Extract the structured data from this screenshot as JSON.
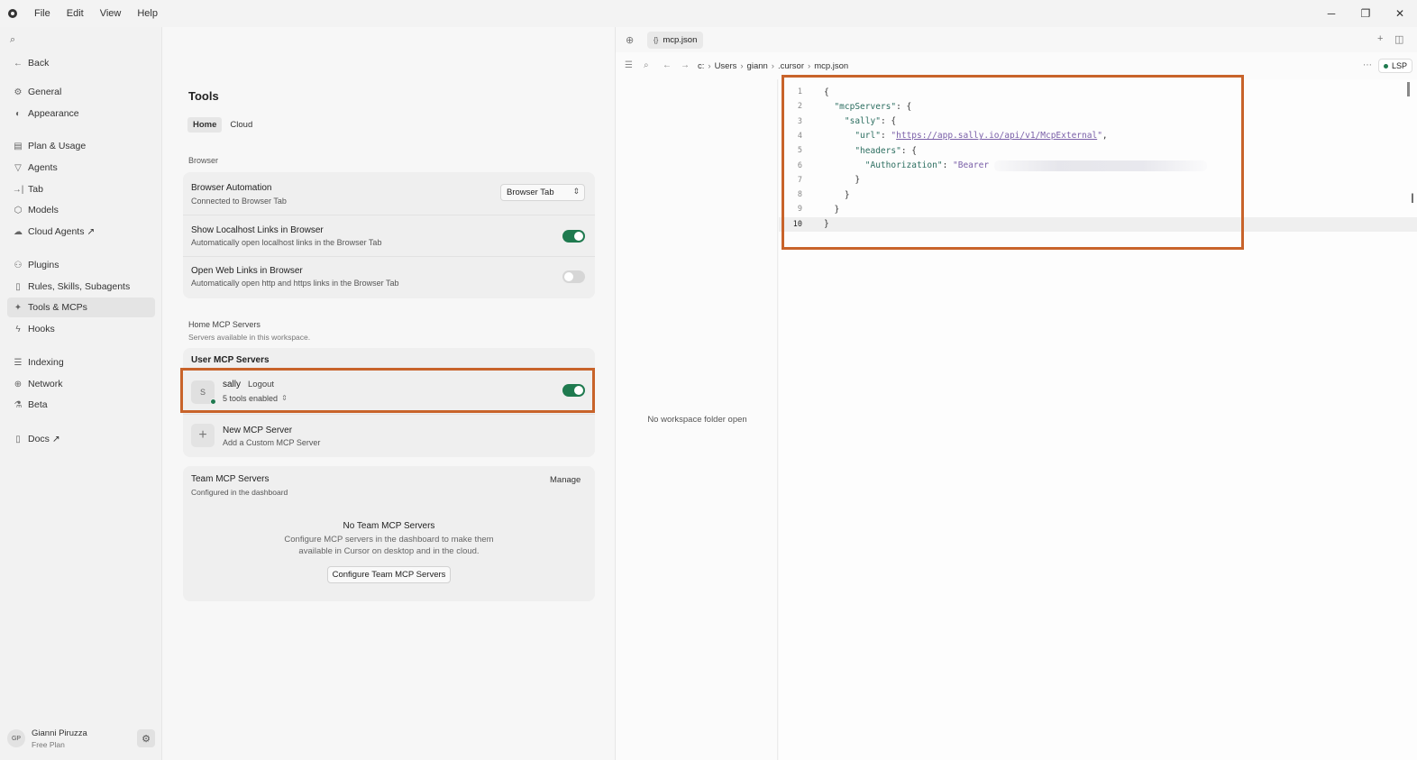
{
  "menubar": {
    "items": [
      "File",
      "Edit",
      "View",
      "Help"
    ],
    "controls": {
      "minimize": "─",
      "restore": "❐",
      "close": "✕"
    }
  },
  "sidebar": {
    "back_label": "Back",
    "items": [
      {
        "label": "General",
        "icon": "⚙"
      },
      {
        "label": "Appearance",
        "icon": "◐"
      },
      {
        "label": "Plan & Usage",
        "icon": "▤"
      },
      {
        "label": "Agents",
        "icon": "▽"
      },
      {
        "label": "Tab",
        "icon": "→|"
      },
      {
        "label": "Models",
        "icon": "⬡"
      },
      {
        "label": "Cloud Agents ↗",
        "icon": "☁"
      },
      {
        "label": "Plugins",
        "icon": "⚇"
      },
      {
        "label": "Rules, Skills, Subagents",
        "icon": "▯"
      },
      {
        "label": "Tools & MCPs",
        "icon": "✦"
      },
      {
        "label": "Hooks",
        "icon": "ϟ"
      },
      {
        "label": "Indexing",
        "icon": "☰"
      },
      {
        "label": "Network",
        "icon": "⊕"
      },
      {
        "label": "Beta",
        "icon": "⚗"
      },
      {
        "label": "Docs ↗",
        "icon": "▯"
      }
    ],
    "active_item": "Tools & MCPs",
    "user": {
      "initials": "GP",
      "name": "Gianni Piruzza",
      "plan": "Free Plan"
    }
  },
  "settings": {
    "title": "Tools",
    "tabs": [
      "Home",
      "Cloud"
    ],
    "browser_section": "Browser",
    "browser_automation": {
      "title": "Browser Automation",
      "subtitle": "Connected to Browser Tab",
      "select_value": "Browser Tab"
    },
    "localhost_links": {
      "title": "Show Localhost Links in Browser",
      "subtitle": "Automatically open localhost links in the Browser Tab",
      "enabled": true
    },
    "web_links": {
      "title": "Open Web Links in Browser",
      "subtitle": "Automatically open http and https links in the Browser Tab",
      "enabled": false
    },
    "home_mcp": {
      "title": "Home MCP Servers",
      "subtitle": "Servers available in this workspace."
    },
    "user_mcp": {
      "header": "User MCP Servers",
      "server": {
        "initial": "S",
        "name": "sally",
        "action": "Logout",
        "tools": "5 tools enabled",
        "enabled": true
      },
      "new_server": {
        "title": "New MCP Server",
        "subtitle": "Add a Custom MCP Server"
      }
    },
    "team_mcp": {
      "title": "Team MCP Servers",
      "subtitle": "Configured in the dashboard",
      "manage": "Manage",
      "empty_title": "No Team MCP Servers",
      "empty_line1": "Configure MCP servers in the dashboard to make them",
      "empty_line2": "available in Cursor on desktop and in the cloud.",
      "button": "Configure Team MCP Servers"
    }
  },
  "editor": {
    "tab_label": "mcp.json",
    "breadcrumbs": [
      "c:",
      "Users",
      "giann",
      ".cursor",
      "mcp.json"
    ],
    "lsp_label": "LSP",
    "no_folder": "No workspace folder open",
    "lines": [
      {
        "n": "1",
        "parts": [
          [
            "p",
            "{"
          ]
        ]
      },
      {
        "n": "2",
        "parts": [
          [
            "p",
            "  "
          ],
          [
            "k",
            "\"mcpServers\""
          ],
          [
            "p",
            ": {"
          ]
        ]
      },
      {
        "n": "3",
        "parts": [
          [
            "p",
            "    "
          ],
          [
            "k",
            "\"sally\""
          ],
          [
            "p",
            ": {"
          ]
        ]
      },
      {
        "n": "4",
        "parts": [
          [
            "p",
            "      "
          ],
          [
            "k",
            "\"url\""
          ],
          [
            "p",
            ": "
          ],
          [
            "s",
            "\""
          ],
          [
            "url",
            "https://app.sally.io/api/v1/McpExternal"
          ],
          [
            "s",
            "\""
          ],
          [
            "p",
            ","
          ]
        ]
      },
      {
        "n": "5",
        "parts": [
          [
            "p",
            "      "
          ],
          [
            "k",
            "\"headers\""
          ],
          [
            "p",
            ": {"
          ]
        ]
      },
      {
        "n": "6",
        "parts": [
          [
            "p",
            "        "
          ],
          [
            "k",
            "\"Authorization\""
          ],
          [
            "p",
            ": "
          ],
          [
            "s",
            "\"Bearer"
          ],
          [
            "blur",
            ""
          ]
        ]
      },
      {
        "n": "7",
        "parts": [
          [
            "p",
            "      }"
          ]
        ]
      },
      {
        "n": "8",
        "parts": [
          [
            "p",
            "    }"
          ]
        ]
      },
      {
        "n": "9",
        "parts": [
          [
            "p",
            "  }"
          ]
        ]
      },
      {
        "n": "10",
        "parts": [
          [
            "p",
            "}"
          ]
        ]
      }
    ],
    "current_line": "10"
  },
  "colors": {
    "accent_green": "#1f7a4f",
    "highlight_orange": "#c8632a"
  }
}
